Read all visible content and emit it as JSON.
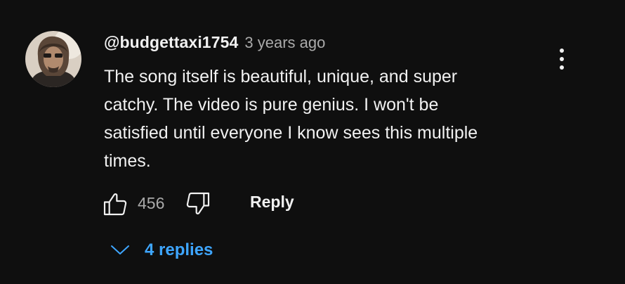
{
  "comment": {
    "author": "@budgettaxi1754",
    "timestamp": "3 years ago",
    "text_lines": [
      "The song itself is beautiful, unique, and super",
      "catchy. The video is pure genius. I won't be",
      "satisfied until everyone I know sees this multiple",
      "times."
    ],
    "like_count": "456",
    "reply_label": "Reply",
    "replies_label": "4 replies"
  },
  "icons": {
    "avatar": "avatar",
    "like": "thumbs-up-icon",
    "dislike": "thumbs-down-icon",
    "menu": "more-vertical-icon",
    "expand": "chevron-down-icon"
  },
  "colors": {
    "background": "#0f0f0f",
    "text": "#f1f1f1",
    "secondary_text": "#aaaaaa",
    "link": "#3ea6ff"
  }
}
